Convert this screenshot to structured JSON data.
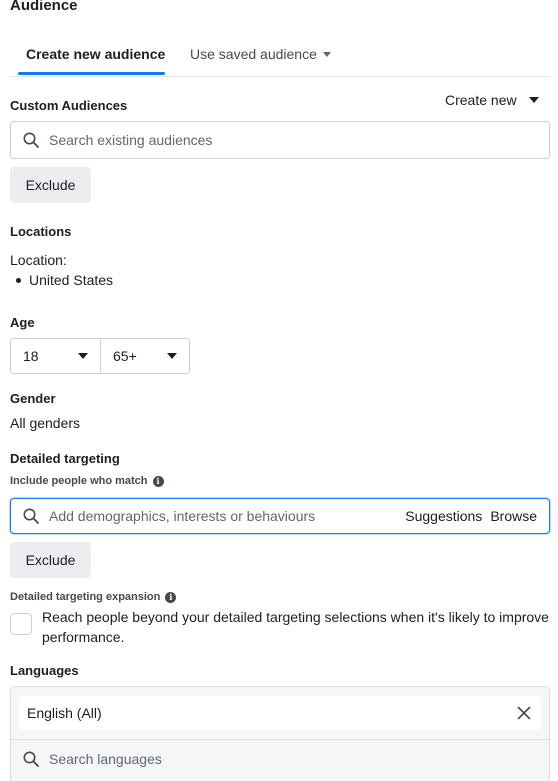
{
  "section_title": "Audience",
  "tabs": {
    "create_new": "Create new audience",
    "use_saved": "Use saved audience"
  },
  "custom_audiences": {
    "label": "Custom Audiences",
    "create_new": "Create new",
    "search_placeholder": "Search existing audiences",
    "exclude": "Exclude"
  },
  "locations": {
    "label": "Locations",
    "location_prefix": "Location:",
    "items": [
      "United States"
    ]
  },
  "age": {
    "label": "Age",
    "min": "18",
    "max": "65+"
  },
  "gender": {
    "label": "Gender",
    "value": "All genders"
  },
  "detailed_targeting": {
    "label": "Detailed targeting",
    "include_label": "Include people who match",
    "search_placeholder": "Add demographics, interests or behaviours",
    "suggestions": "Suggestions",
    "browse": "Browse",
    "exclude": "Exclude",
    "expansion_label": "Detailed targeting expansion",
    "expansion_text": "Reach people beyond your detailed targeting selections when it's likely to improve performance.",
    "expansion_checked": false
  },
  "languages": {
    "label": "Languages",
    "selected": [
      "English (All)"
    ],
    "search_placeholder": "Search languages"
  },
  "colors": {
    "accent": "#1877f2",
    "text": "#1c1e21",
    "button_bg": "#ebedf0"
  }
}
